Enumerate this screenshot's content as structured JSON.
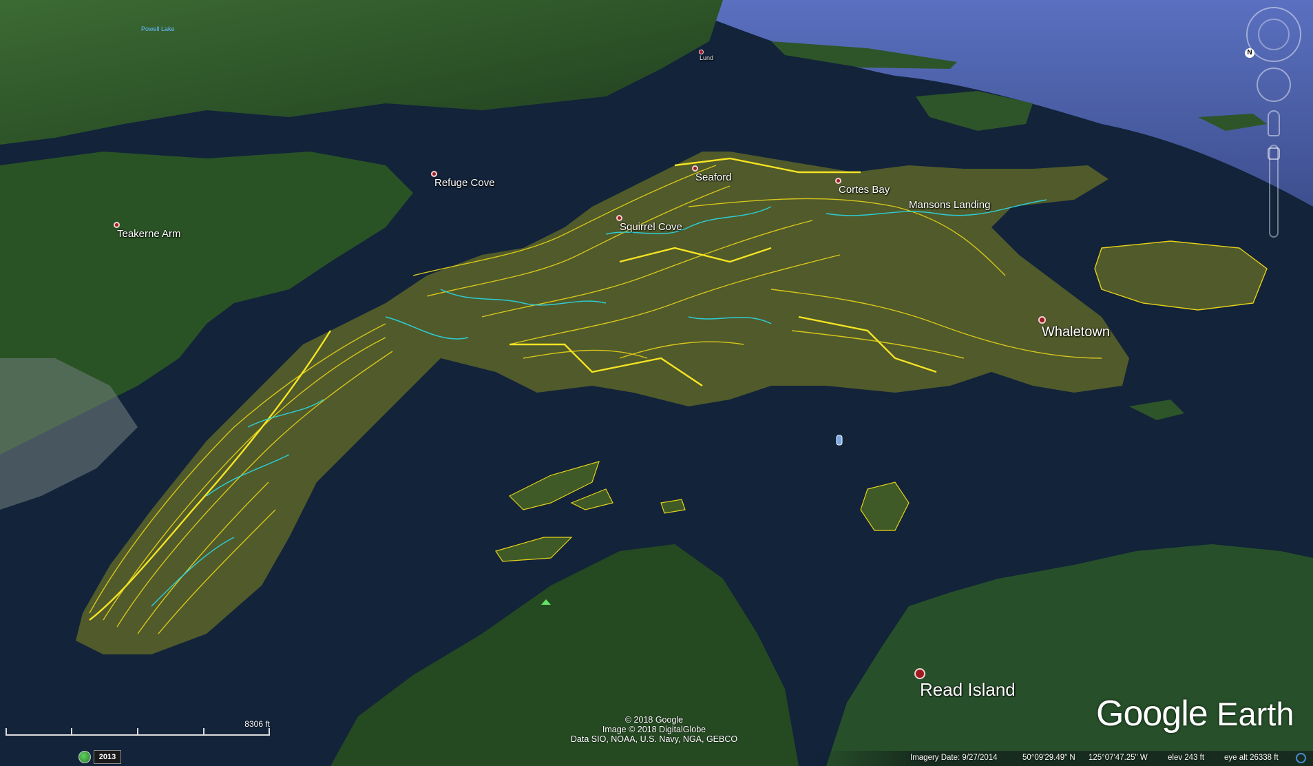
{
  "places": {
    "teakerne_arm": "Teakerne Arm",
    "refuge_cove": "Refuge Cove",
    "squirrel_cove": "Squirrel Cove",
    "seaford": "Seaford",
    "cortes_bay": "Cortes Bay",
    "mansons_landing": "Mansons Landing",
    "whaletown": "Whaletown",
    "read_island": "Read Island",
    "lund": "Lund",
    "powell_lake": "Powell Lake"
  },
  "scale": {
    "label": "8306 ft"
  },
  "history": {
    "year": "2013"
  },
  "credits": {
    "line1": "© 2018 Google",
    "line2": "Image © 2018 DigitalGlobe",
    "line3": "Data SIO, NOAA, U.S. Navy, NGA, GEBCO"
  },
  "logo": {
    "word1": "Google",
    "word2": "Earth"
  },
  "status": {
    "imagery_date": "Imagery Date: 9/27/2014",
    "lat": "50°09'29.49\" N",
    "lon": "125°07'47.25\" W",
    "elev": "elev   243 ft",
    "eye_alt": "eye alt  26338 ft"
  },
  "colors": {
    "water": "#0f1d2b",
    "land": "#2f5a2a",
    "contour": "#e6d21a",
    "stream": "#2ad8e6",
    "place_dot": "#a11a22"
  },
  "icons": [
    "north-arrow-icon",
    "compass-ring-icon",
    "look-joystick-icon",
    "pegman-icon",
    "zoom-slider-icon",
    "history-clock-icon",
    "peak-marker-icon",
    "info-marker-icon"
  ]
}
